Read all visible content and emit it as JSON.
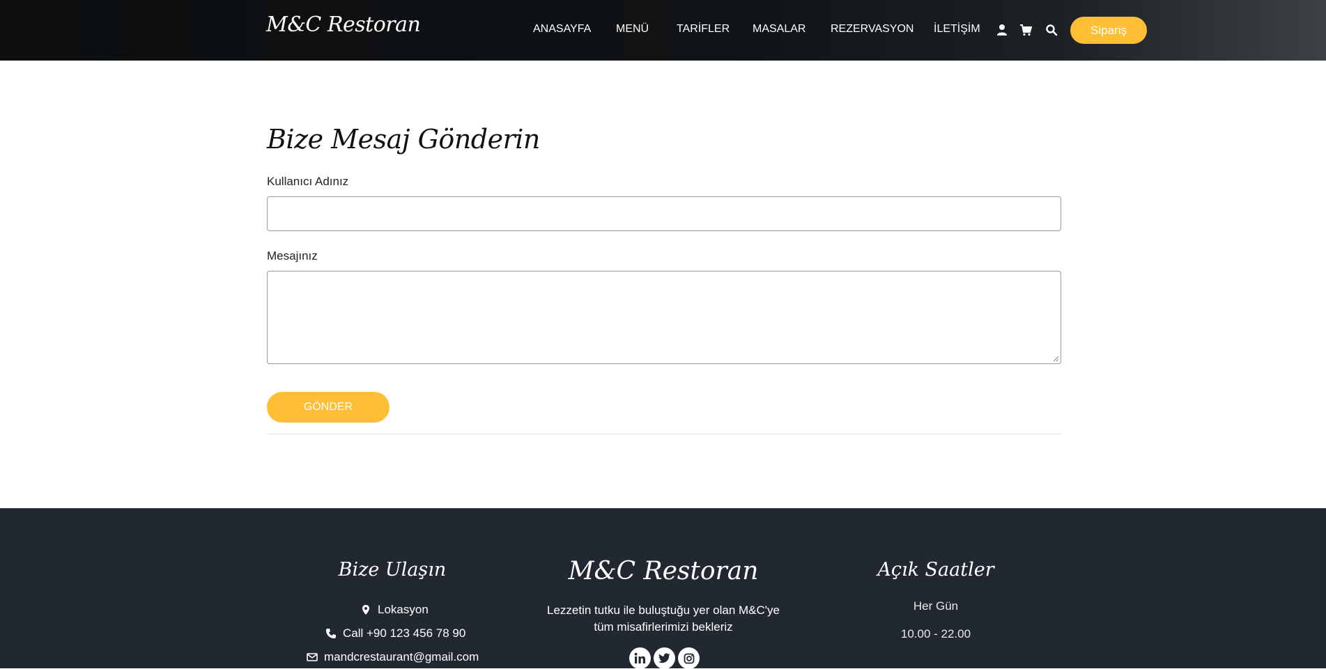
{
  "header": {
    "brand": "M&C Restoran",
    "nav": [
      {
        "label": "ANASAYFA"
      },
      {
        "label": "MENÜ"
      },
      {
        "label": "TARİFLER"
      },
      {
        "label": "MASALAR"
      },
      {
        "label": "REZERVASYON"
      },
      {
        "label": "İLETİŞİM"
      }
    ],
    "icons": [
      "user-icon",
      "cart-icon",
      "search-icon"
    ],
    "order_button": "Sipariş"
  },
  "form": {
    "title": "Bize Mesaj Gönderin",
    "username_label": "Kullanıcı Adınız",
    "username_value": "",
    "message_label": "Mesajınız",
    "message_value": "",
    "submit_label": "GÖNDER"
  },
  "footer": {
    "contact": {
      "title": "Bize Ulaşın",
      "location": "Lokasyon",
      "phone": "Call +90 123 456 78 90",
      "email": "mandcrestaurant@gmail.com"
    },
    "about": {
      "title": "M&C Restoran",
      "description_line1": "Lezzetin tutku ile buluştuğu yer olan M&C'ye",
      "description_line2": "tüm misafirlerimizi bekleriz",
      "social": [
        "linkedin-icon",
        "twitter-icon",
        "instagram-icon"
      ]
    },
    "hours": {
      "title": "Açık Saatler",
      "days": "Her Gün",
      "time": "10.00 - 22.00"
    }
  },
  "colors": {
    "accent": "#ffbe33",
    "footer_bg": "#222831",
    "header_bg": "#0c0e10"
  }
}
